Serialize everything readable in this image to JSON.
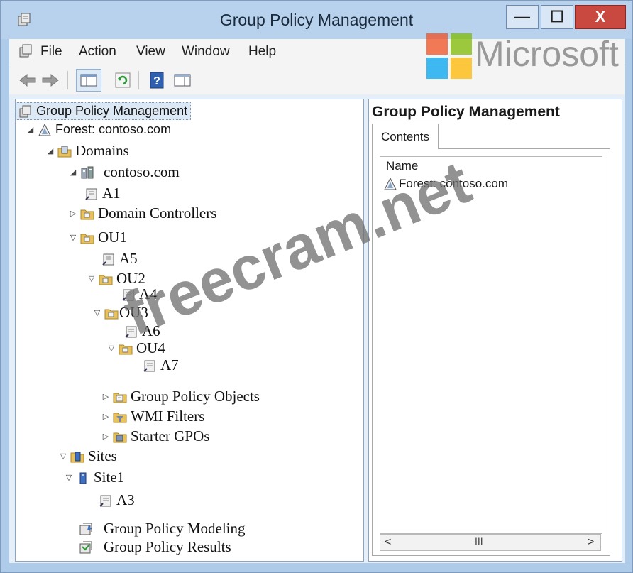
{
  "window": {
    "title": "Group Policy Management",
    "min_glyph": "—",
    "max_glyph": "☐",
    "close_glyph": "X"
  },
  "menu": [
    "File",
    "Action",
    "View",
    "Window",
    "Help"
  ],
  "toolbar": [
    "back-arrow-icon",
    "forward-arrow-icon",
    "show-hide-tree-icon",
    "refresh-icon",
    "help-icon",
    "properties-icon"
  ],
  "tree": {
    "root": "Group Policy Management",
    "forest": "Forest: contoso.com",
    "domains": "Domains",
    "domain": "contoso.com",
    "a1": "A1",
    "domain_controllers": "Domain Controllers",
    "ou1": "OU1",
    "a5": "A5",
    "ou2": "OU2",
    "a4": "A4",
    "ou3": "OU3",
    "a6": "A6",
    "ou4": "OU4",
    "a7": "A7",
    "gpo": "Group Policy Objects",
    "wmi": "WMI Filters",
    "starter": "Starter GPOs",
    "sites": "Sites",
    "site1": "Site1",
    "a3": "A3",
    "modeling": "Group Policy Modeling",
    "results": "Group Policy Results"
  },
  "right_pane": {
    "title": "Group Policy Management",
    "tab": "Contents",
    "column": "Name",
    "row": "Forest: contoso.com",
    "scroll_left": "<",
    "scroll_right": ">",
    "scroll_grip": "III"
  },
  "watermarks": {
    "brand": "Microsoft",
    "site": "freecram.net"
  },
  "colors": {
    "ms_red": "#f25022",
    "ms_green": "#7fba00",
    "ms_blue": "#00a4ef",
    "ms_yellow": "#ffb900"
  }
}
